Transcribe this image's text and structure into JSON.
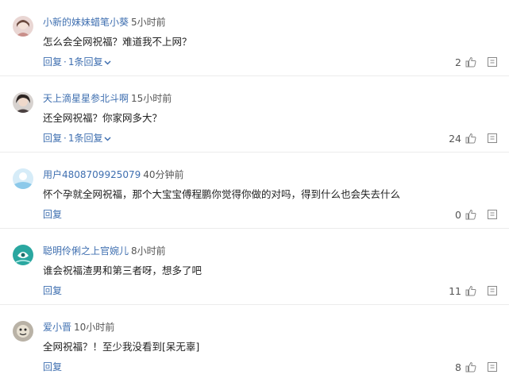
{
  "comments": [
    {
      "user": "小新的妹妹蜡笔小葵",
      "time": "5小时前",
      "text": "怎么会全网祝福？难道我不上网？",
      "reply_label": "回复",
      "sep": "·",
      "replies_label": "1条回复",
      "likes": "2",
      "avatar": "avatar-girl-icon"
    },
    {
      "user": "天上滴星星参北斗啊",
      "time": "15小时前",
      "text": "还全网祝福？你家网多大？",
      "reply_label": "回复",
      "sep": "·",
      "replies_label": "1条回复",
      "likes": "24",
      "avatar": "avatar-dark-hair-icon"
    },
    {
      "user": "用户4808709925079",
      "time": "40分钟前",
      "text": "怀个孕就全网祝福，那个大宝宝傅程鹏你觉得你做的对吗，得到什么也会失去什么",
      "reply_label": "回复",
      "likes": "0",
      "avatar": "avatar-default-blue-icon"
    },
    {
      "user": "聪明伶俐之上官婉儿",
      "time": "8小时前",
      "text": "谁会祝福渣男和第三者呀，想多了吧",
      "reply_label": "回复",
      "likes": "11",
      "avatar": "avatar-teal-icon"
    },
    {
      "user": "爱小晋",
      "time": "10小时前",
      "text": "全网祝福？！至少我没看到[呆无辜]",
      "reply_label": "回复",
      "likes": "8",
      "avatar": "avatar-cartoon-icon"
    }
  ],
  "colors": {
    "link": "#3f6fb0",
    "text": "#222222",
    "muted": "#555555",
    "divider": "#ececec"
  }
}
